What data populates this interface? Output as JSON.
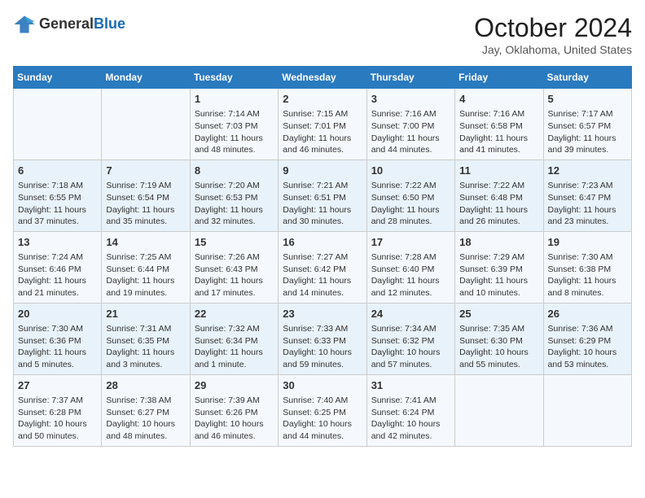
{
  "logo": {
    "text_general": "General",
    "text_blue": "Blue"
  },
  "title": {
    "month": "October 2024",
    "location": "Jay, Oklahoma, United States"
  },
  "weekdays": [
    "Sunday",
    "Monday",
    "Tuesday",
    "Wednesday",
    "Thursday",
    "Friday",
    "Saturday"
  ],
  "weeks": [
    [
      {
        "day": "",
        "info": ""
      },
      {
        "day": "",
        "info": ""
      },
      {
        "day": "1",
        "info": "Sunrise: 7:14 AM\nSunset: 7:03 PM\nDaylight: 11 hours and 48 minutes."
      },
      {
        "day": "2",
        "info": "Sunrise: 7:15 AM\nSunset: 7:01 PM\nDaylight: 11 hours and 46 minutes."
      },
      {
        "day": "3",
        "info": "Sunrise: 7:16 AM\nSunset: 7:00 PM\nDaylight: 11 hours and 44 minutes."
      },
      {
        "day": "4",
        "info": "Sunrise: 7:16 AM\nSunset: 6:58 PM\nDaylight: 11 hours and 41 minutes."
      },
      {
        "day": "5",
        "info": "Sunrise: 7:17 AM\nSunset: 6:57 PM\nDaylight: 11 hours and 39 minutes."
      }
    ],
    [
      {
        "day": "6",
        "info": "Sunrise: 7:18 AM\nSunset: 6:55 PM\nDaylight: 11 hours and 37 minutes."
      },
      {
        "day": "7",
        "info": "Sunrise: 7:19 AM\nSunset: 6:54 PM\nDaylight: 11 hours and 35 minutes."
      },
      {
        "day": "8",
        "info": "Sunrise: 7:20 AM\nSunset: 6:53 PM\nDaylight: 11 hours and 32 minutes."
      },
      {
        "day": "9",
        "info": "Sunrise: 7:21 AM\nSunset: 6:51 PM\nDaylight: 11 hours and 30 minutes."
      },
      {
        "day": "10",
        "info": "Sunrise: 7:22 AM\nSunset: 6:50 PM\nDaylight: 11 hours and 28 minutes."
      },
      {
        "day": "11",
        "info": "Sunrise: 7:22 AM\nSunset: 6:48 PM\nDaylight: 11 hours and 26 minutes."
      },
      {
        "day": "12",
        "info": "Sunrise: 7:23 AM\nSunset: 6:47 PM\nDaylight: 11 hours and 23 minutes."
      }
    ],
    [
      {
        "day": "13",
        "info": "Sunrise: 7:24 AM\nSunset: 6:46 PM\nDaylight: 11 hours and 21 minutes."
      },
      {
        "day": "14",
        "info": "Sunrise: 7:25 AM\nSunset: 6:44 PM\nDaylight: 11 hours and 19 minutes."
      },
      {
        "day": "15",
        "info": "Sunrise: 7:26 AM\nSunset: 6:43 PM\nDaylight: 11 hours and 17 minutes."
      },
      {
        "day": "16",
        "info": "Sunrise: 7:27 AM\nSunset: 6:42 PM\nDaylight: 11 hours and 14 minutes."
      },
      {
        "day": "17",
        "info": "Sunrise: 7:28 AM\nSunset: 6:40 PM\nDaylight: 11 hours and 12 minutes."
      },
      {
        "day": "18",
        "info": "Sunrise: 7:29 AM\nSunset: 6:39 PM\nDaylight: 11 hours and 10 minutes."
      },
      {
        "day": "19",
        "info": "Sunrise: 7:30 AM\nSunset: 6:38 PM\nDaylight: 11 hours and 8 minutes."
      }
    ],
    [
      {
        "day": "20",
        "info": "Sunrise: 7:30 AM\nSunset: 6:36 PM\nDaylight: 11 hours and 5 minutes."
      },
      {
        "day": "21",
        "info": "Sunrise: 7:31 AM\nSunset: 6:35 PM\nDaylight: 11 hours and 3 minutes."
      },
      {
        "day": "22",
        "info": "Sunrise: 7:32 AM\nSunset: 6:34 PM\nDaylight: 11 hours and 1 minute."
      },
      {
        "day": "23",
        "info": "Sunrise: 7:33 AM\nSunset: 6:33 PM\nDaylight: 10 hours and 59 minutes."
      },
      {
        "day": "24",
        "info": "Sunrise: 7:34 AM\nSunset: 6:32 PM\nDaylight: 10 hours and 57 minutes."
      },
      {
        "day": "25",
        "info": "Sunrise: 7:35 AM\nSunset: 6:30 PM\nDaylight: 10 hours and 55 minutes."
      },
      {
        "day": "26",
        "info": "Sunrise: 7:36 AM\nSunset: 6:29 PM\nDaylight: 10 hours and 53 minutes."
      }
    ],
    [
      {
        "day": "27",
        "info": "Sunrise: 7:37 AM\nSunset: 6:28 PM\nDaylight: 10 hours and 50 minutes."
      },
      {
        "day": "28",
        "info": "Sunrise: 7:38 AM\nSunset: 6:27 PM\nDaylight: 10 hours and 48 minutes."
      },
      {
        "day": "29",
        "info": "Sunrise: 7:39 AM\nSunset: 6:26 PM\nDaylight: 10 hours and 46 minutes."
      },
      {
        "day": "30",
        "info": "Sunrise: 7:40 AM\nSunset: 6:25 PM\nDaylight: 10 hours and 44 minutes."
      },
      {
        "day": "31",
        "info": "Sunrise: 7:41 AM\nSunset: 6:24 PM\nDaylight: 10 hours and 42 minutes."
      },
      {
        "day": "",
        "info": ""
      },
      {
        "day": "",
        "info": ""
      }
    ]
  ]
}
